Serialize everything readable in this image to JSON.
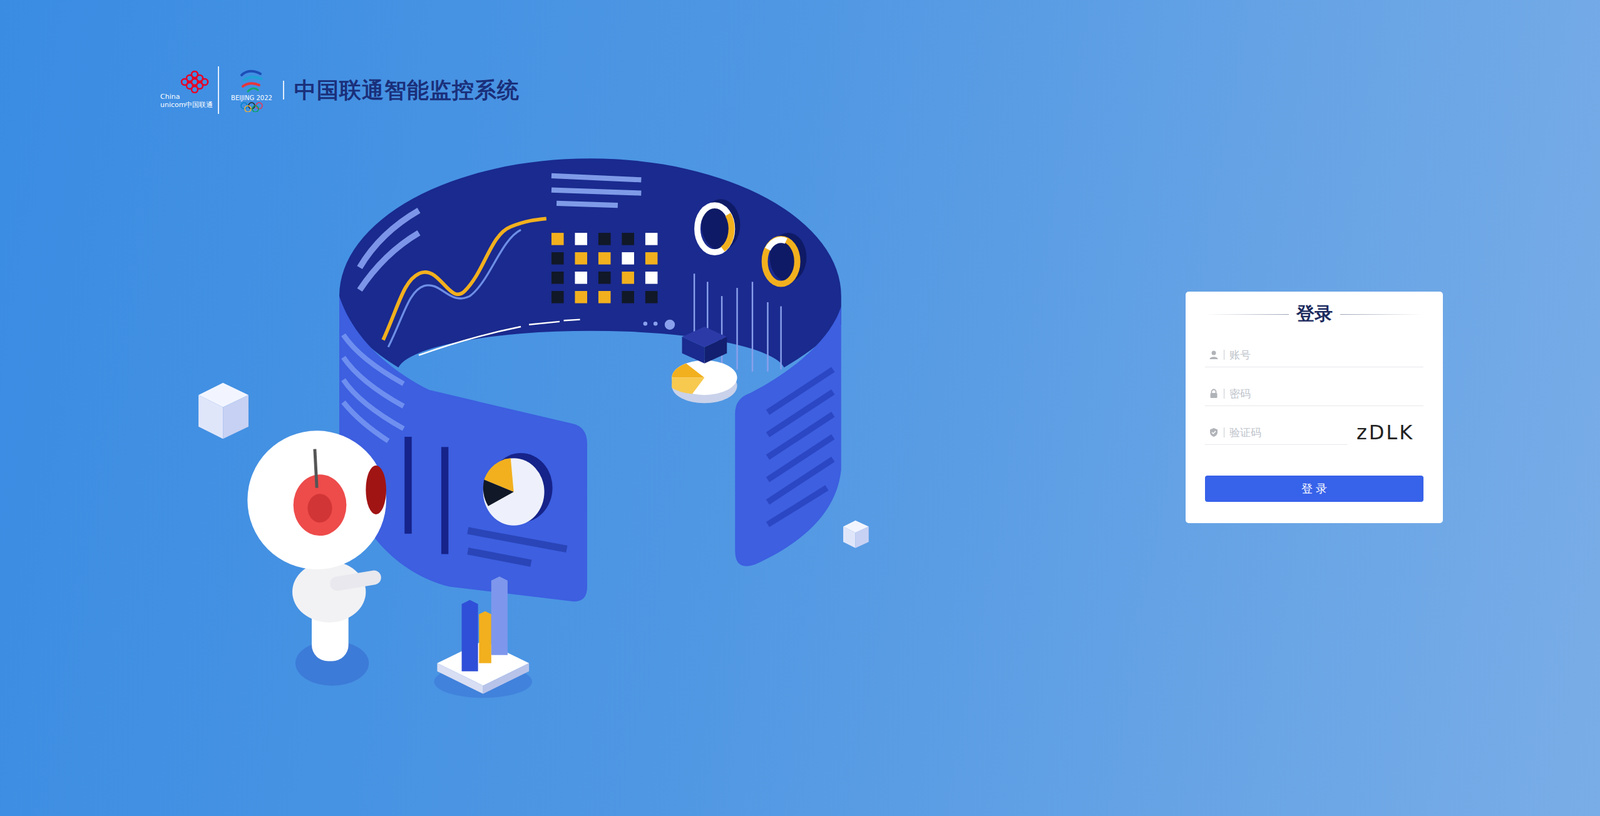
{
  "header": {
    "logo": {
      "line1": "China",
      "line2": "unicom中国联通",
      "emblem": "BEIJING 2022"
    },
    "title": "中国联通智能监控系统"
  },
  "login": {
    "title": "登录",
    "fields": [
      {
        "placeholder": "账号",
        "kind": "user"
      },
      {
        "placeholder": "密码",
        "kind": "password"
      },
      {
        "placeholder": "验证码",
        "kind": "captcha"
      }
    ],
    "captcha": "zDLK",
    "button": "登 录"
  }
}
